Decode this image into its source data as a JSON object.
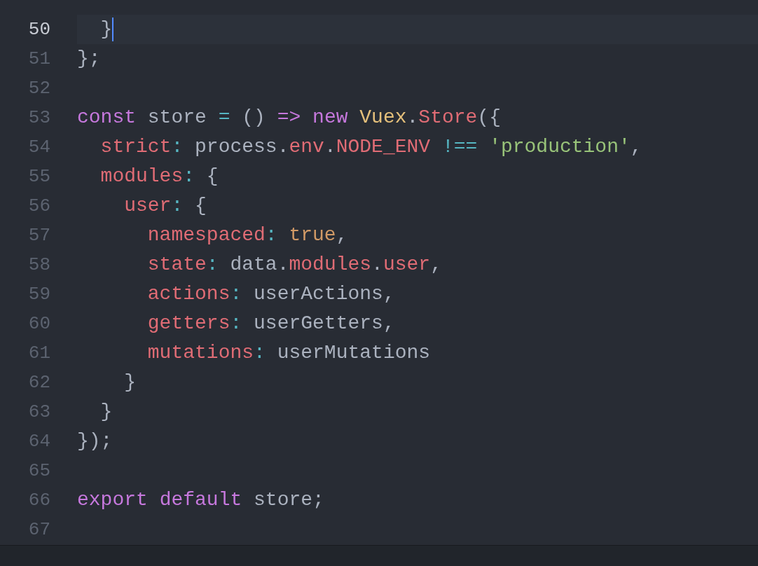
{
  "editor": {
    "lines": [
      {
        "number": "50",
        "selected": true,
        "cursor": true,
        "tokens": [
          {
            "text": "  }",
            "kind": "plain"
          }
        ]
      },
      {
        "number": "51",
        "selected": false,
        "cursor": false,
        "tokens": [
          {
            "text": "};",
            "kind": "plain"
          }
        ]
      },
      {
        "number": "52",
        "selected": false,
        "cursor": false
      },
      {
        "number": "53",
        "selected": false,
        "cursor": false,
        "tokens": [
          {
            "text": "const",
            "kind": "keyword"
          },
          {
            "text": " store ",
            "kind": "plain"
          },
          {
            "text": "=",
            "kind": "operator"
          },
          {
            "text": " () ",
            "kind": "plain"
          },
          {
            "text": "=>",
            "kind": "keyword"
          },
          {
            "text": " new",
            "kind": "keyword"
          },
          {
            "text": " Vuex",
            "kind": "class"
          },
          {
            "text": ".",
            "kind": "plain"
          },
          {
            "text": "Store",
            "kind": "property"
          },
          {
            "text": "({",
            "kind": "plain"
          }
        ]
      },
      {
        "number": "54",
        "selected": false,
        "cursor": false,
        "tokens": [
          {
            "text": "  strict",
            "kind": "property"
          },
          {
            "text": ":",
            "kind": "operator"
          },
          {
            "text": " process.",
            "kind": "plain"
          },
          {
            "text": "env",
            "kind": "property"
          },
          {
            "text": ".",
            "kind": "plain"
          },
          {
            "text": "NODE_ENV",
            "kind": "property"
          },
          {
            "text": " !==",
            "kind": "operator"
          },
          {
            "text": " 'production'",
            "kind": "string"
          },
          {
            "text": ",",
            "kind": "plain"
          }
        ]
      },
      {
        "number": "55",
        "selected": false,
        "cursor": false,
        "tokens": [
          {
            "text": "  modules",
            "kind": "property"
          },
          {
            "text": ":",
            "kind": "operator"
          },
          {
            "text": " {",
            "kind": "plain"
          }
        ]
      },
      {
        "number": "56",
        "selected": false,
        "cursor": false,
        "tokens": [
          {
            "text": "    user",
            "kind": "property"
          },
          {
            "text": ":",
            "kind": "operator"
          },
          {
            "text": " {",
            "kind": "plain"
          }
        ]
      },
      {
        "number": "57",
        "selected": false,
        "cursor": false,
        "tokens": [
          {
            "text": "      namespaced",
            "kind": "property"
          },
          {
            "text": ":",
            "kind": "operator"
          },
          {
            "text": " true",
            "kind": "constant"
          },
          {
            "text": ",",
            "kind": "plain"
          }
        ]
      },
      {
        "number": "58",
        "selected": false,
        "cursor": false,
        "tokens": [
          {
            "text": "      state",
            "kind": "property"
          },
          {
            "text": ":",
            "kind": "operator"
          },
          {
            "text": " data.",
            "kind": "plain"
          },
          {
            "text": "modules",
            "kind": "property"
          },
          {
            "text": ".",
            "kind": "plain"
          },
          {
            "text": "user",
            "kind": "property"
          },
          {
            "text": ",",
            "kind": "plain"
          }
        ]
      },
      {
        "number": "59",
        "selected": false,
        "cursor": false,
        "tokens": [
          {
            "text": "      actions",
            "kind": "property"
          },
          {
            "text": ":",
            "kind": "operator"
          },
          {
            "text": " userActions,",
            "kind": "plain"
          }
        ]
      },
      {
        "number": "60",
        "selected": false,
        "cursor": false,
        "tokens": [
          {
            "text": "      getters",
            "kind": "property"
          },
          {
            "text": ":",
            "kind": "operator"
          },
          {
            "text": " userGetters,",
            "kind": "plain"
          }
        ]
      },
      {
        "number": "61",
        "selected": false,
        "cursor": false,
        "tokens": [
          {
            "text": "      mutations",
            "kind": "property"
          },
          {
            "text": ":",
            "kind": "operator"
          },
          {
            "text": " userMutations",
            "kind": "plain"
          }
        ]
      },
      {
        "number": "62",
        "selected": false,
        "cursor": false,
        "tokens": [
          {
            "text": "    }",
            "kind": "plain"
          }
        ]
      },
      {
        "number": "63",
        "selected": false,
        "cursor": false,
        "tokens": [
          {
            "text": "  }",
            "kind": "plain"
          }
        ]
      },
      {
        "number": "64",
        "selected": false,
        "cursor": false,
        "tokens": [
          {
            "text": "});",
            "kind": "plain"
          }
        ]
      },
      {
        "number": "65",
        "selected": false,
        "cursor": false
      },
      {
        "number": "66",
        "selected": false,
        "cursor": false,
        "tokens": [
          {
            "text": "export",
            "kind": "keyword"
          },
          {
            "text": " default",
            "kind": "keyword"
          },
          {
            "text": " store;",
            "kind": "plain"
          }
        ]
      },
      {
        "number": "67",
        "selected": false,
        "cursor": false
      }
    ]
  }
}
